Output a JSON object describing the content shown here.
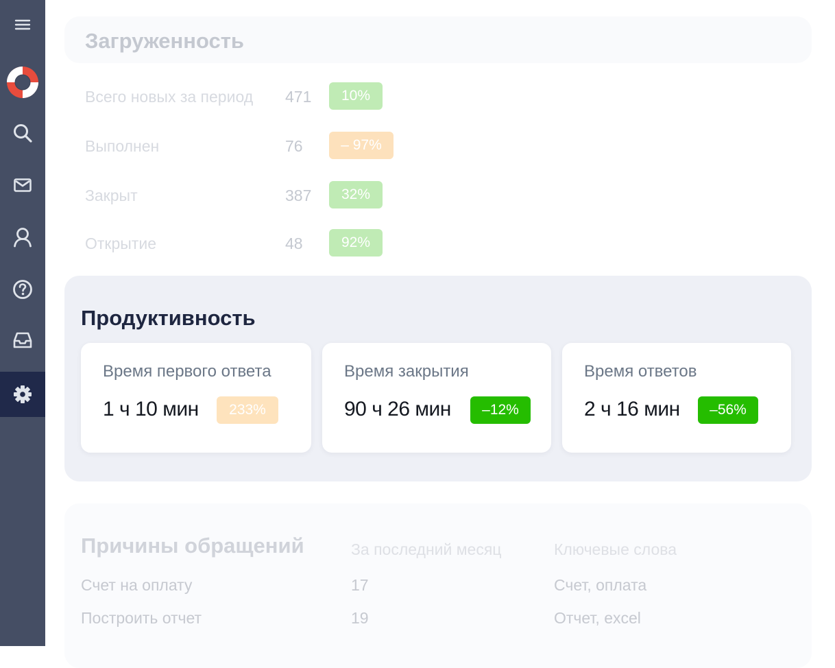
{
  "sidebar": {
    "items": [
      {
        "icon": "menu-icon"
      },
      {
        "icon": "lifebuoy-icon"
      },
      {
        "icon": "search-icon"
      },
      {
        "icon": "mail-icon"
      },
      {
        "icon": "user-icon"
      },
      {
        "icon": "help-icon"
      },
      {
        "icon": "inbox-icon"
      },
      {
        "icon": "gear-icon",
        "active": true
      }
    ],
    "colors": {
      "background": "#454e64",
      "active": "#20294a",
      "lifebuoy_red": "#e84c3d"
    }
  },
  "load": {
    "title": "Загруженность",
    "rows": [
      {
        "label": "Всего новых за период",
        "value": "471",
        "badge": "10%",
        "badge_color": "#c0ebb5"
      },
      {
        "label": "Выполнен",
        "value": "76",
        "badge": "– 97%",
        "badge_color": "#fde1bc"
      },
      {
        "label": "Закрыт",
        "value": "387",
        "badge": "32%",
        "badge_color": "#c0ebb5"
      },
      {
        "label": "Открытие",
        "value": "48",
        "badge": "92%",
        "badge_color": "#c0ebb5"
      }
    ]
  },
  "productivity": {
    "title": "Продуктивность",
    "cards": [
      {
        "label": "Время первого ответа",
        "value": "1 ч 10 мин",
        "badge": "233%",
        "badge_color": "#fee3bd"
      },
      {
        "label": "Время закрытия",
        "value": "90 ч 26 мин",
        "badge": "–12%",
        "badge_color": "#25bd00"
      },
      {
        "label": "Время ответов",
        "value": "2 ч 16 мин",
        "badge": "–56%",
        "badge_color": "#25bd00"
      }
    ]
  },
  "reasons": {
    "title": "Причины обращений",
    "columns": [
      "За последний месяц",
      "Ключевые слова"
    ],
    "rows": [
      {
        "reason": "Счет на оплату",
        "count": "17",
        "keywords": "Счет, оплата"
      },
      {
        "reason": "Построить отчет",
        "count": "19",
        "keywords": "Отчет, excel"
      }
    ]
  }
}
